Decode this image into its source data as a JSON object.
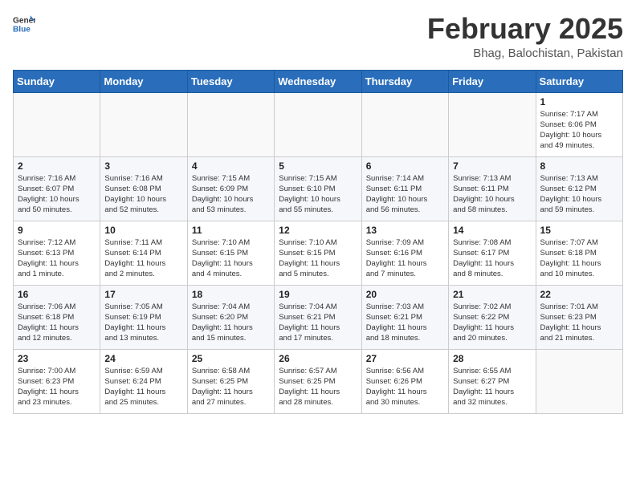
{
  "logo": {
    "general": "General",
    "blue": "Blue"
  },
  "title": "February 2025",
  "subtitle": "Bhag, Balochistan, Pakistan",
  "days_of_week": [
    "Sunday",
    "Monday",
    "Tuesday",
    "Wednesday",
    "Thursday",
    "Friday",
    "Saturday"
  ],
  "weeks": [
    [
      {
        "num": "",
        "info": ""
      },
      {
        "num": "",
        "info": ""
      },
      {
        "num": "",
        "info": ""
      },
      {
        "num": "",
        "info": ""
      },
      {
        "num": "",
        "info": ""
      },
      {
        "num": "",
        "info": ""
      },
      {
        "num": "1",
        "info": "Sunrise: 7:17 AM\nSunset: 6:06 PM\nDaylight: 10 hours\nand 49 minutes."
      }
    ],
    [
      {
        "num": "2",
        "info": "Sunrise: 7:16 AM\nSunset: 6:07 PM\nDaylight: 10 hours\nand 50 minutes."
      },
      {
        "num": "3",
        "info": "Sunrise: 7:16 AM\nSunset: 6:08 PM\nDaylight: 10 hours\nand 52 minutes."
      },
      {
        "num": "4",
        "info": "Sunrise: 7:15 AM\nSunset: 6:09 PM\nDaylight: 10 hours\nand 53 minutes."
      },
      {
        "num": "5",
        "info": "Sunrise: 7:15 AM\nSunset: 6:10 PM\nDaylight: 10 hours\nand 55 minutes."
      },
      {
        "num": "6",
        "info": "Sunrise: 7:14 AM\nSunset: 6:11 PM\nDaylight: 10 hours\nand 56 minutes."
      },
      {
        "num": "7",
        "info": "Sunrise: 7:13 AM\nSunset: 6:11 PM\nDaylight: 10 hours\nand 58 minutes."
      },
      {
        "num": "8",
        "info": "Sunrise: 7:13 AM\nSunset: 6:12 PM\nDaylight: 10 hours\nand 59 minutes."
      }
    ],
    [
      {
        "num": "9",
        "info": "Sunrise: 7:12 AM\nSunset: 6:13 PM\nDaylight: 11 hours\nand 1 minute."
      },
      {
        "num": "10",
        "info": "Sunrise: 7:11 AM\nSunset: 6:14 PM\nDaylight: 11 hours\nand 2 minutes."
      },
      {
        "num": "11",
        "info": "Sunrise: 7:10 AM\nSunset: 6:15 PM\nDaylight: 11 hours\nand 4 minutes."
      },
      {
        "num": "12",
        "info": "Sunrise: 7:10 AM\nSunset: 6:15 PM\nDaylight: 11 hours\nand 5 minutes."
      },
      {
        "num": "13",
        "info": "Sunrise: 7:09 AM\nSunset: 6:16 PM\nDaylight: 11 hours\nand 7 minutes."
      },
      {
        "num": "14",
        "info": "Sunrise: 7:08 AM\nSunset: 6:17 PM\nDaylight: 11 hours\nand 8 minutes."
      },
      {
        "num": "15",
        "info": "Sunrise: 7:07 AM\nSunset: 6:18 PM\nDaylight: 11 hours\nand 10 minutes."
      }
    ],
    [
      {
        "num": "16",
        "info": "Sunrise: 7:06 AM\nSunset: 6:18 PM\nDaylight: 11 hours\nand 12 minutes."
      },
      {
        "num": "17",
        "info": "Sunrise: 7:05 AM\nSunset: 6:19 PM\nDaylight: 11 hours\nand 13 minutes."
      },
      {
        "num": "18",
        "info": "Sunrise: 7:04 AM\nSunset: 6:20 PM\nDaylight: 11 hours\nand 15 minutes."
      },
      {
        "num": "19",
        "info": "Sunrise: 7:04 AM\nSunset: 6:21 PM\nDaylight: 11 hours\nand 17 minutes."
      },
      {
        "num": "20",
        "info": "Sunrise: 7:03 AM\nSunset: 6:21 PM\nDaylight: 11 hours\nand 18 minutes."
      },
      {
        "num": "21",
        "info": "Sunrise: 7:02 AM\nSunset: 6:22 PM\nDaylight: 11 hours\nand 20 minutes."
      },
      {
        "num": "22",
        "info": "Sunrise: 7:01 AM\nSunset: 6:23 PM\nDaylight: 11 hours\nand 21 minutes."
      }
    ],
    [
      {
        "num": "23",
        "info": "Sunrise: 7:00 AM\nSunset: 6:23 PM\nDaylight: 11 hours\nand 23 minutes."
      },
      {
        "num": "24",
        "info": "Sunrise: 6:59 AM\nSunset: 6:24 PM\nDaylight: 11 hours\nand 25 minutes."
      },
      {
        "num": "25",
        "info": "Sunrise: 6:58 AM\nSunset: 6:25 PM\nDaylight: 11 hours\nand 27 minutes."
      },
      {
        "num": "26",
        "info": "Sunrise: 6:57 AM\nSunset: 6:25 PM\nDaylight: 11 hours\nand 28 minutes."
      },
      {
        "num": "27",
        "info": "Sunrise: 6:56 AM\nSunset: 6:26 PM\nDaylight: 11 hours\nand 30 minutes."
      },
      {
        "num": "28",
        "info": "Sunrise: 6:55 AM\nSunset: 6:27 PM\nDaylight: 11 hours\nand 32 minutes."
      },
      {
        "num": "",
        "info": ""
      }
    ]
  ]
}
